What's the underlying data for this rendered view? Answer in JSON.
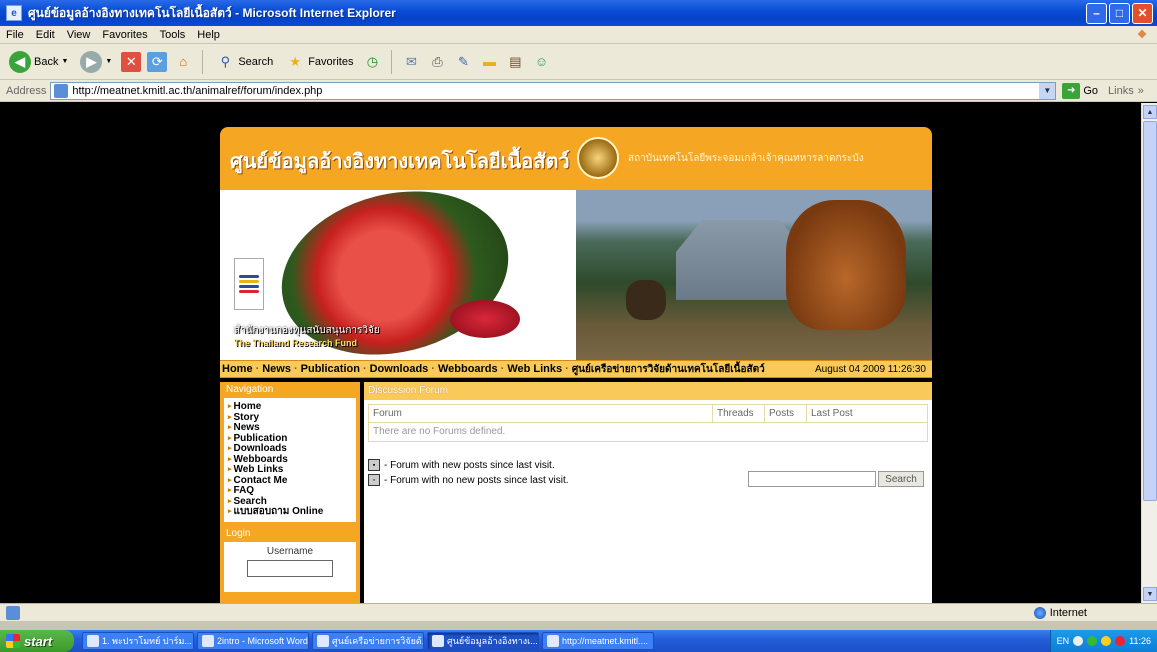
{
  "window": {
    "title": "ศูนย์ข้อมูลอ้างอิงทางเทคโนโลยีเนื้อสัตว์ - Microsoft Internet Explorer",
    "minimize": "–",
    "maximize": "□",
    "close": "✕"
  },
  "menu": [
    "File",
    "Edit",
    "View",
    "Favorites",
    "Tools",
    "Help"
  ],
  "toolbar": {
    "back": "Back",
    "search": "Search",
    "favorites": "Favorites"
  },
  "address": {
    "label": "Address",
    "url": "http://meatnet.kmitl.ac.th/animalref/forum/index.php",
    "go": "Go",
    "links": "Links"
  },
  "site": {
    "title": "ศูนย์ข้อมูลอ้างอิงทางเทคโนโลยีเนื้อสัตว์",
    "subtitle": "สถาบันเทคโนโลยีพระจอมเกล้าเจ้าคุณทหารลาดกระบัง",
    "trf_name_th": "สำนักงานกองทุนสนับสนุนการวิจัย",
    "trf_name_en": "The Thailand Research Fund",
    "nav": [
      "Home",
      "News",
      "Publication",
      "Downloads",
      "Webboards",
      "Web Links",
      "ศูนย์เครือข่ายการวิจัยด้านเทคโนโลยีเนื้อสัตว์"
    ],
    "date": "August 04 2009 11:26:30"
  },
  "sidebar": {
    "nav_title": "Navigation",
    "items": [
      "Home",
      "Story",
      "News",
      "Publication",
      "Downloads",
      "Webboards",
      "Web Links",
      "Contact Me",
      "FAQ",
      "Search",
      "แบบสอบถาม Online"
    ],
    "login_title": "Login",
    "username_label": "Username"
  },
  "forum": {
    "title": "Discussion Forum",
    "columns": [
      "Forum",
      "Threads",
      "Posts",
      "Last Post"
    ],
    "empty": "There are no Forums defined.",
    "legend_new": "- Forum with new posts since last visit.",
    "legend_none": "- Forum with no new posts since last visit.",
    "search_button": "Search"
  },
  "status": {
    "zone": "Internet"
  },
  "taskbar": {
    "start": "start",
    "tasks": [
      "1. พะปราโมทย์ ปาร์ม...",
      "2intro - Microsoft Word",
      "ศูนย์เครือข่ายการวิจัยด้...",
      "ศูนย์ข้อมูลอ้างอิงทางเ...",
      "http://meatnet.kmitl...."
    ],
    "lang": "EN",
    "time": "11:26"
  },
  "colors": {
    "site_orange": "#f5a623",
    "nav_yellow": "#f9c95a",
    "xp_blue": "#0a4ed6"
  }
}
